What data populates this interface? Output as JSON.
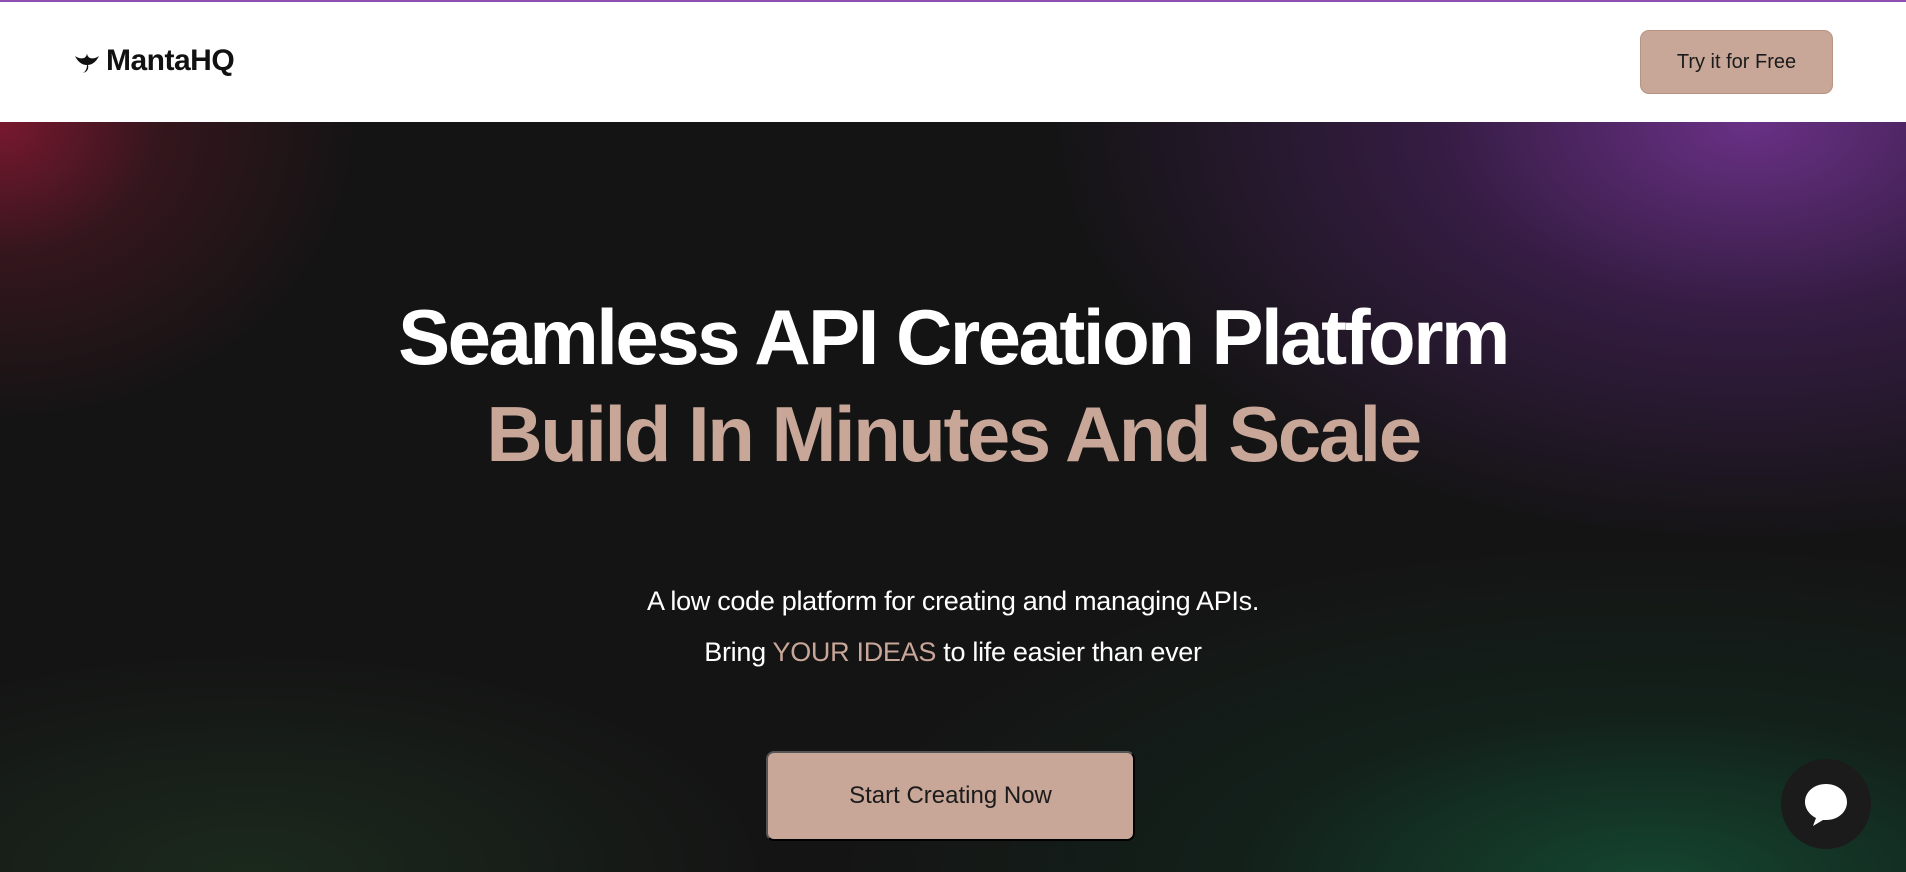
{
  "header": {
    "brand": "MantaHQ",
    "logo_icon": "manta-ray-icon",
    "cta_label": "Try it for Free"
  },
  "hero": {
    "headline_line1": "Seamless API Creation Platform",
    "headline_line2": "Build In Minutes And Scale",
    "subtitle_line1": "A low code platform for creating and managing APIs.",
    "subtitle_line2_prefix": "Bring ",
    "subtitle_line2_highlight": "YOUR IDEAS",
    "subtitle_line2_suffix": " to life easier than ever",
    "cta_label": "Start Creating Now"
  },
  "chat_widget": {
    "icon": "chat-bubble-icon"
  },
  "colors": {
    "accent": "#c8a698",
    "hero_background": "#141414",
    "top_border": "#8e4fb0",
    "chat_widget": "#1b1b1b"
  }
}
